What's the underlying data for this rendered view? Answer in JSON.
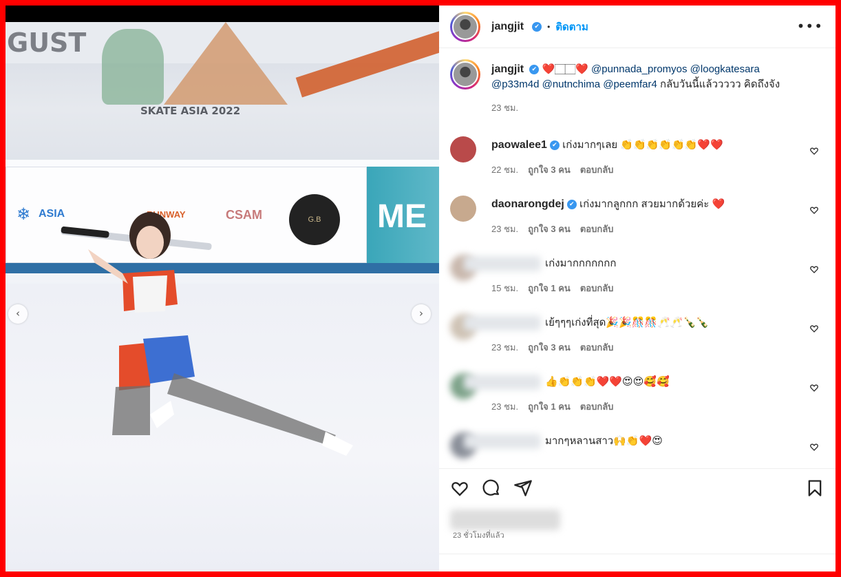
{
  "post": {
    "username": "jangjit",
    "follow_label": "ติดตาม",
    "more_label": "•••",
    "caption": {
      "text_parts": [
        {
          "t": "❤️",
          "mention": false
        },
        {
          "t": "🏻🏻",
          "mention": false
        },
        {
          "t": "❤️ ",
          "mention": false
        },
        {
          "t": "@punnada_promyos",
          "mention": true
        },
        {
          "t": " ",
          "mention": false
        },
        {
          "t": "@loogkatesara",
          "mention": true
        },
        {
          "t": " ",
          "mention": false
        },
        {
          "t": "@p33m4d",
          "mention": true
        },
        {
          "t": " ",
          "mention": false
        },
        {
          "t": "@nutnchima",
          "mention": true
        },
        {
          "t": " ",
          "mention": false
        },
        {
          "t": "@peemfar4",
          "mention": true
        },
        {
          "t": " กลับวันนี้แล้ววววว คิดถึงจัง",
          "mention": false
        }
      ],
      "time": "23 ชม."
    },
    "comments": [
      {
        "user": "paowalee1",
        "verified": true,
        "text": "เก่งมากๆเลย 👏👏👏👏👏👏❤️❤️",
        "time": "22 ชม.",
        "likes": "ถูกใจ 3 คน",
        "reply": "ตอบกลับ",
        "blurred": false,
        "avatar_color": "#b94a4a"
      },
      {
        "user": "daonarongdej",
        "verified": true,
        "text": "เก่งมากลูกกก สวยมากด้วยค่ะ ❤️",
        "time": "23 ชม.",
        "likes": "ถูกใจ 3 คน",
        "reply": "ตอบกลับ",
        "blurred": false,
        "avatar_color": "#c7a98e"
      },
      {
        "user": "",
        "verified": false,
        "text": "เก่งมากกกกกกก",
        "time": "15 ชม.",
        "likes": "ถูกใจ 1 คน",
        "reply": "ตอบกลับ",
        "blurred": true,
        "avatar_color": "#c9b8ad"
      },
      {
        "user": "",
        "verified": false,
        "text": "เย้ๆๆๆเก่งที่สุด🎉🎉🎊🎊🥂🥂🍾🍾",
        "time": "23 ชม.",
        "likes": "ถูกใจ 3 คน",
        "reply": "ตอบกลับ",
        "blurred": true,
        "avatar_color": "#cfc3b5"
      },
      {
        "user": "",
        "verified": false,
        "text": "👍👏👏👏❤️❤️😍😍🥰🥰",
        "time": "23 ชม.",
        "likes": "ถูกใจ 1 คน",
        "reply": "ตอบกลับ",
        "blurred": true,
        "avatar_color": "#7ea38a"
      },
      {
        "user": "",
        "verified": false,
        "text": "มากๆหลานสาว🙌👏❤️😍",
        "time": "",
        "likes": "",
        "reply": "",
        "blurred": true,
        "avatar_color": "#8a8f99"
      }
    ],
    "timestamp": "23 ชั่วโมงที่แล้ว"
  },
  "photo": {
    "wall_text_1": "GUST",
    "wall_text_2": "SKATE ASIA 2022",
    "logo_1": "ASIA",
    "logo_2": "RUNWAY",
    "logo_3": "CSAM",
    "logo_4": "G.B",
    "right_banner": "ME"
  },
  "nav": {
    "prev": "‹",
    "next": "›"
  },
  "carousel": {
    "count": 7,
    "active": 5
  },
  "icons": {
    "like": "heart-icon",
    "comment": "comment-icon",
    "share": "share-icon",
    "save": "bookmark-icon"
  }
}
